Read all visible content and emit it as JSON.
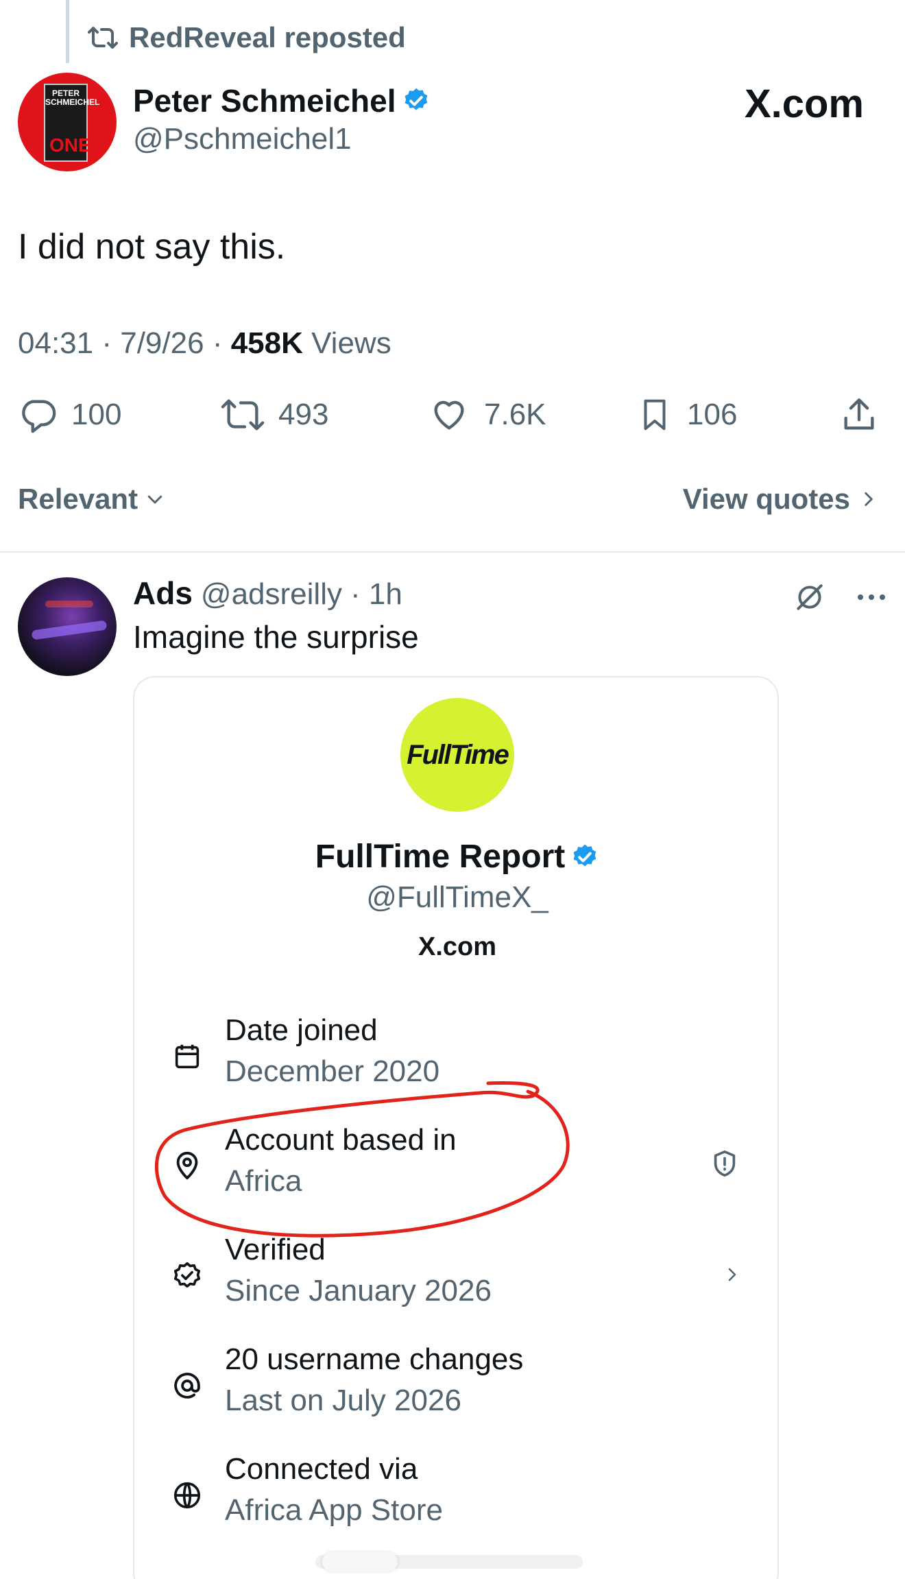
{
  "repost": {
    "text": "RedReveal reposted",
    "icon": "repost-icon"
  },
  "tweet": {
    "author_name": "Peter Schmeichel",
    "author_handle": "@Pschmeichel1",
    "verified": true,
    "source_watermark": "X.com",
    "avatar_book_name": "PETER SCHMEICHEL",
    "avatar_book_title": "ONE",
    "text": "I did not say this.",
    "time": "04:31",
    "date": "7/9/26",
    "views_count": "458K",
    "views_label": "Views",
    "sep": "·"
  },
  "actions": {
    "replies": "100",
    "reposts": "493",
    "likes": "7.6K",
    "bookmarks": "106"
  },
  "sort": {
    "label": "Relevant",
    "view_quotes": "View quotes"
  },
  "reply": {
    "name": "Ads",
    "handle": "@adsreilly",
    "time": "· 1h",
    "text": "Imagine the surprise"
  },
  "card": {
    "logo_text": "FullTime",
    "name": "FullTime Report",
    "handle": "@FullTimeX_",
    "watermark": "X.com",
    "rows": [
      {
        "label": "Date joined",
        "value": "December 2020",
        "icon": "calendar-icon"
      },
      {
        "label": "Account based in",
        "value": "Africa",
        "icon": "location-pin-icon"
      },
      {
        "label": "Verified",
        "value": "Since January 2026",
        "icon": "verified-badge-icon"
      },
      {
        "label": "20 username changes",
        "value": "Last on July 2026",
        "icon": "at-sign-icon"
      },
      {
        "label": "Connected via",
        "value": "Africa App Store",
        "icon": "globe-icon"
      }
    ]
  },
  "colors": {
    "verified_blue": "#1d9bf0",
    "annotation_red": "#e0241b",
    "logo_lime": "#d6f032",
    "muted": "#536471"
  }
}
